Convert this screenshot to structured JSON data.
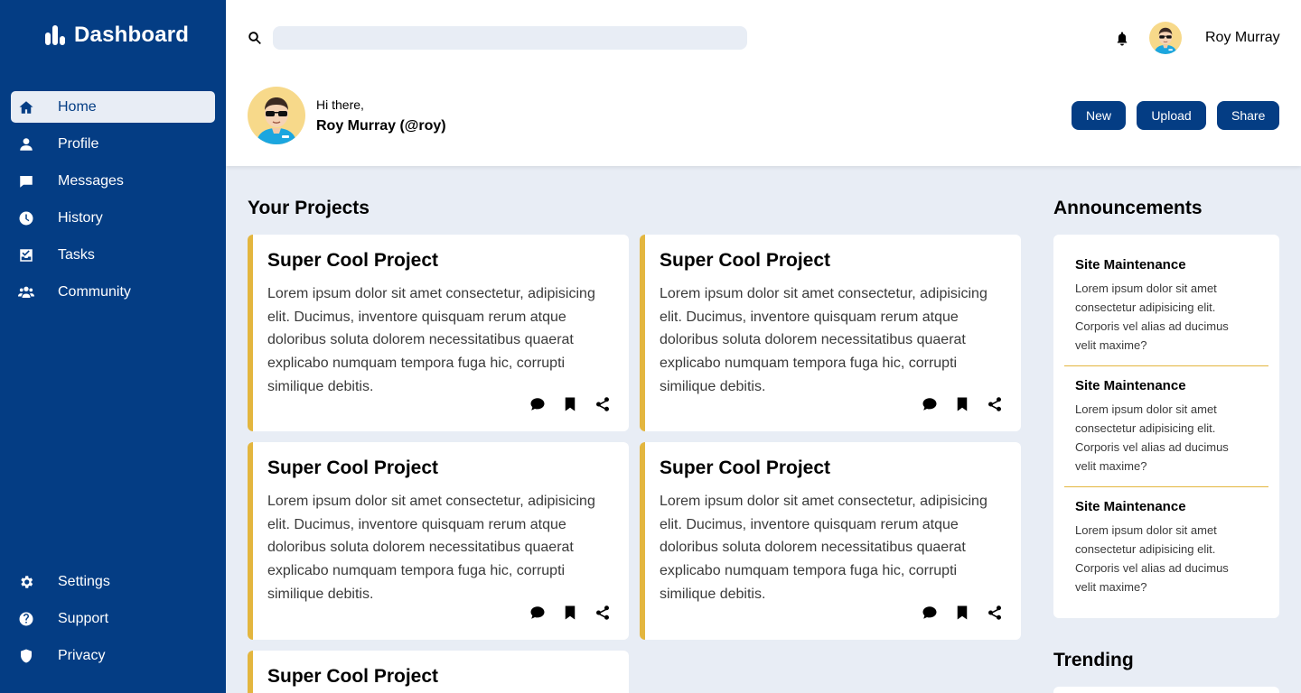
{
  "brand": {
    "title": "Dashboard",
    "icon": "bar-chart-icon"
  },
  "sidebar": {
    "top_items": [
      {
        "label": "Home",
        "icon": "home-icon",
        "active": true
      },
      {
        "label": "Profile",
        "icon": "user-icon"
      },
      {
        "label": "Messages",
        "icon": "message-icon"
      },
      {
        "label": "History",
        "icon": "clock-icon"
      },
      {
        "label": "Tasks",
        "icon": "tasks-icon"
      },
      {
        "label": "Community",
        "icon": "users-icon"
      }
    ],
    "bottom_items": [
      {
        "label": "Settings",
        "icon": "gear-icon"
      },
      {
        "label": "Support",
        "icon": "question-icon"
      },
      {
        "label": "Privacy",
        "icon": "shield-icon"
      }
    ]
  },
  "header": {
    "search_placeholder": "",
    "user_name": "Roy Murray",
    "greeting": "Hi there,",
    "greeting_name": "Roy Murray (@roy)",
    "buttons": {
      "new": "New",
      "upload": "Upload",
      "share": "Share"
    }
  },
  "projects": {
    "title": "Your Projects",
    "items": [
      {
        "title": "Super Cool Project",
        "text": "Lorem ipsum dolor sit amet consectetur, adipisicing elit. Ducimus, inventore quisquam rerum atque doloribus soluta dolorem necessitatibus quaerat explicabo numquam tempora fuga hic, corrupti similique debitis."
      },
      {
        "title": "Super Cool Project",
        "text": "Lorem ipsum dolor sit amet consectetur, adipisicing elit. Ducimus, inventore quisquam rerum atque doloribus soluta dolorem necessitatibus quaerat explicabo numquam tempora fuga hic, corrupti similique debitis."
      },
      {
        "title": "Super Cool Project",
        "text": "Lorem ipsum dolor sit amet consectetur, adipisicing elit. Ducimus, inventore quisquam rerum atque doloribus soluta dolorem necessitatibus quaerat explicabo numquam tempora fuga hic, corrupti similique debitis."
      },
      {
        "title": "Super Cool Project",
        "text": "Lorem ipsum dolor sit amet consectetur, adipisicing elit. Ducimus, inventore quisquam rerum atque doloribus soluta dolorem necessitatibus quaerat explicabo numquam tempora fuga hic, corrupti similique debitis."
      },
      {
        "title": "Super Cool Project",
        "text": ""
      }
    ]
  },
  "announcements": {
    "title": "Announcements",
    "items": [
      {
        "title": "Site Maintenance",
        "text": "Lorem ipsum dolor sit amet consectetur adipisicing elit. Corporis vel alias ad ducimus velit maxime?"
      },
      {
        "title": "Site Maintenance",
        "text": "Lorem ipsum dolor sit amet consectetur adipisicing elit. Corporis vel alias ad ducimus velit maxime?"
      },
      {
        "title": "Site Maintenance",
        "text": "Lorem ipsum dolor sit amet consectetur adipisicing elit. Corporis vel alias ad ducimus velit maxime?"
      }
    ]
  },
  "trending": {
    "title": "Trending"
  },
  "colors": {
    "primary": "#043d84",
    "accent": "#e3b63f",
    "background": "#e8edf5"
  }
}
